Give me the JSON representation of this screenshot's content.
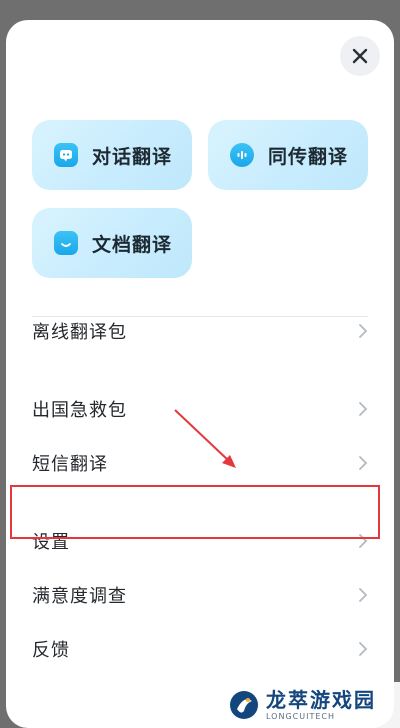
{
  "header": {
    "close_icon": "close-icon"
  },
  "quick_actions": [
    {
      "label": "对话翻译",
      "icon": "chat-translate-icon"
    },
    {
      "label": "同传翻译",
      "icon": "simultaneous-translate-icon"
    },
    {
      "label": "文档翻译",
      "icon": "document-translate-icon"
    }
  ],
  "menu": {
    "items": [
      {
        "label": "离线翻译包"
      },
      {
        "label": "出国急救包"
      },
      {
        "label": "短信翻译"
      },
      {
        "label": "设置"
      },
      {
        "label": "满意度调查"
      },
      {
        "label": "反馈"
      }
    ]
  },
  "annotation": {
    "highlight_color": "#e4383c",
    "highlighted_item": "设置"
  },
  "watermark": {
    "name": "龙萃游戏园",
    "subtitle": "LONGCUITECH"
  },
  "colors": {
    "accent": "#1aa7ea",
    "card_bg": "#c7ecfd",
    "overlay": "#6f6f6f"
  }
}
